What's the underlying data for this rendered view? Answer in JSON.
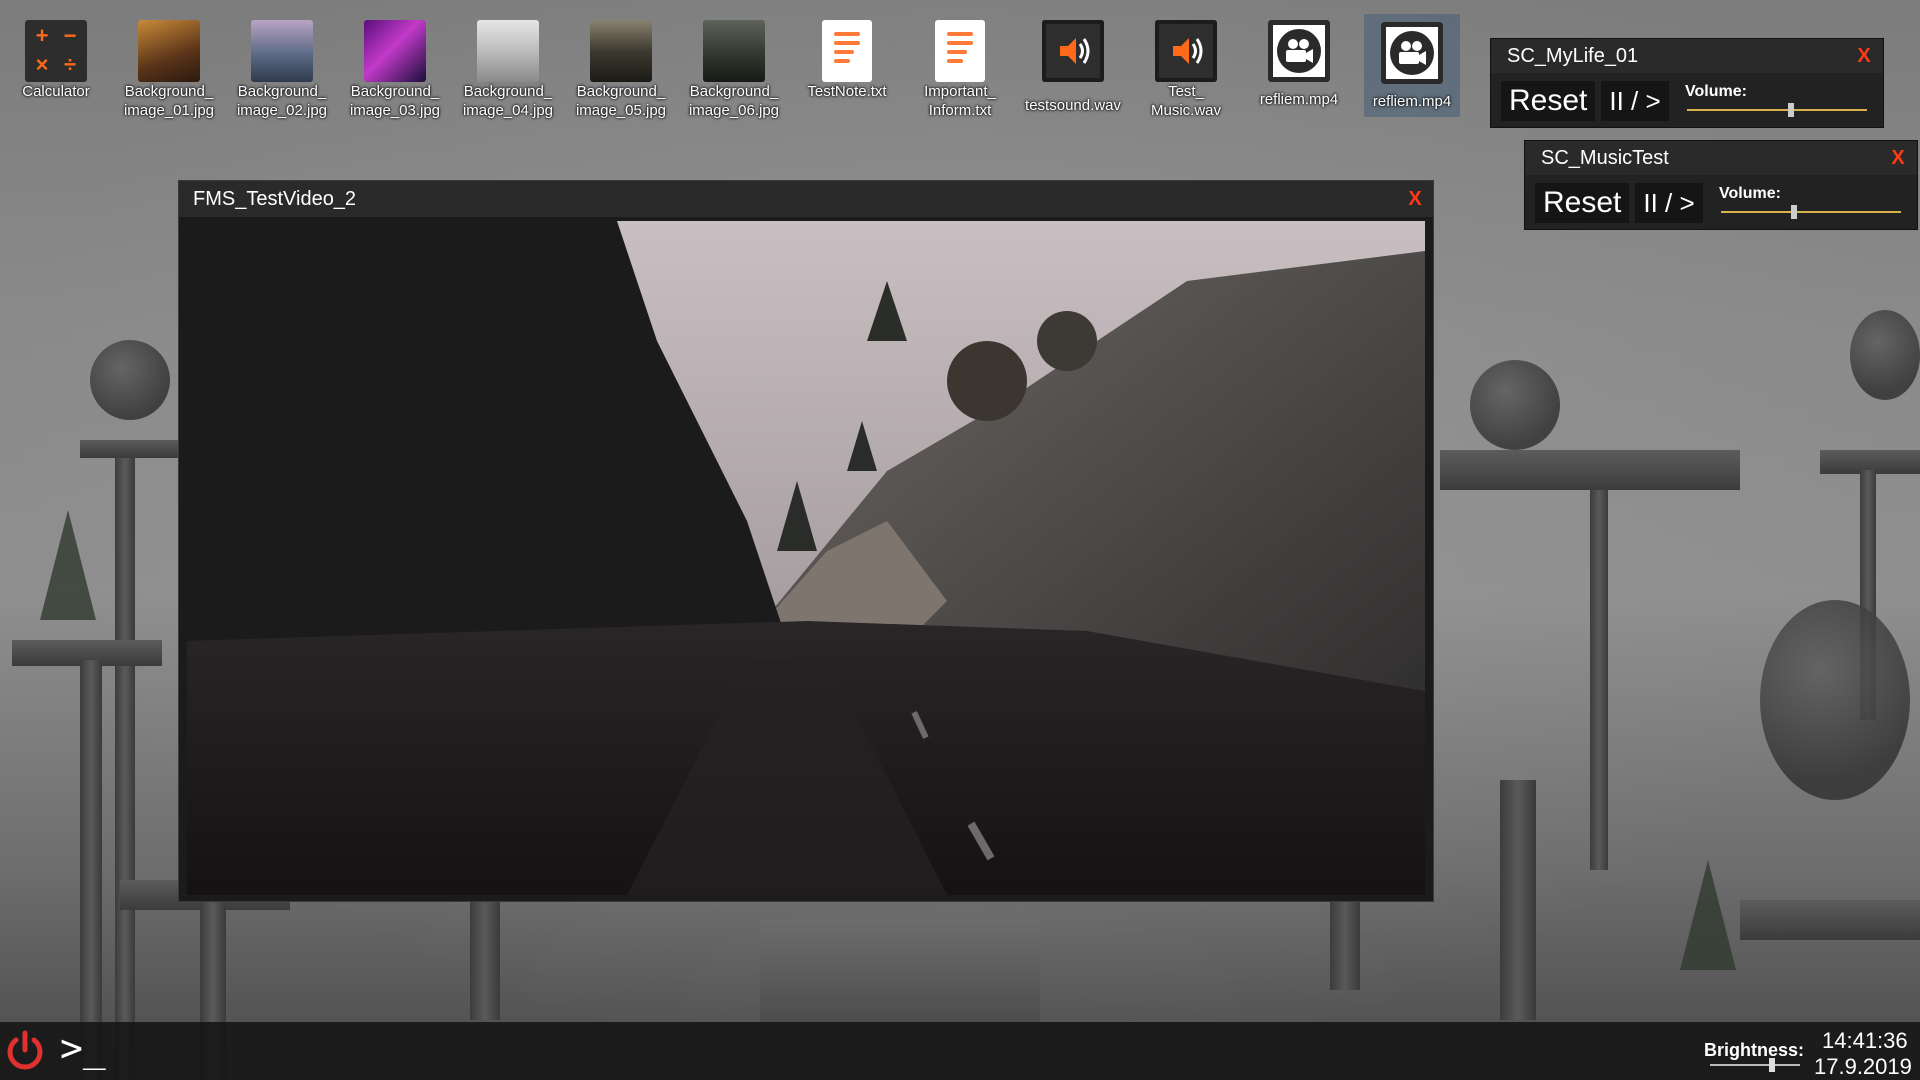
{
  "desktop": {
    "icons": [
      {
        "label": "Calculator",
        "icon": "calculator-icon"
      },
      {
        "label": "Background_\nimage_01.jpg",
        "icon": "image-thumbnail-icon"
      },
      {
        "label": "Background_\nimage_02.jpg",
        "icon": "image-thumbnail-icon"
      },
      {
        "label": "Background_\nimage_03.jpg",
        "icon": "image-thumbnail-icon"
      },
      {
        "label": "Background_\nimage_04.jpg",
        "icon": "image-thumbnail-icon"
      },
      {
        "label": "Background_\nimage_05.jpg",
        "icon": "image-thumbnail-icon"
      },
      {
        "label": "Background_\nimage_06.jpg",
        "icon": "image-thumbnail-icon"
      },
      {
        "label": "TestNote.txt",
        "icon": "text-document-icon"
      },
      {
        "label": "Important_\nInform.txt",
        "icon": "text-document-icon"
      },
      {
        "label": "testsound.wav",
        "icon": "speaker-icon"
      },
      {
        "label": "Test_\nMusic.wav",
        "icon": "speaker-icon"
      },
      {
        "label": "refliem.mp4",
        "icon": "video-camera-icon"
      },
      {
        "label": "refliem.mp4",
        "icon": "video-camera-icon",
        "selected": true
      }
    ]
  },
  "media_controls": [
    {
      "title": "SC_MyLife_01",
      "close": "X",
      "reset": "Reset",
      "playpause": "II / >",
      "volume_label": "Volume:",
      "volume_level": 0.58
    },
    {
      "title": "SC_MusicTest",
      "close": "X",
      "reset": "Reset",
      "playpause": "II / >",
      "volume_label": "Volume:",
      "volume_level": 0.4
    }
  ],
  "video_window": {
    "title": "FMS_TestVideo_2",
    "close": "X"
  },
  "taskbar": {
    "power_icon": "power-icon",
    "terminal_label": ">_",
    "brightness_label": "Brightness:",
    "brightness_level": 0.7,
    "time": "14:41:36",
    "date": "17.9.2019"
  },
  "colors": {
    "accent": "#ff6a1a",
    "close": "#ff3a14",
    "slider": "#d8b24a"
  }
}
